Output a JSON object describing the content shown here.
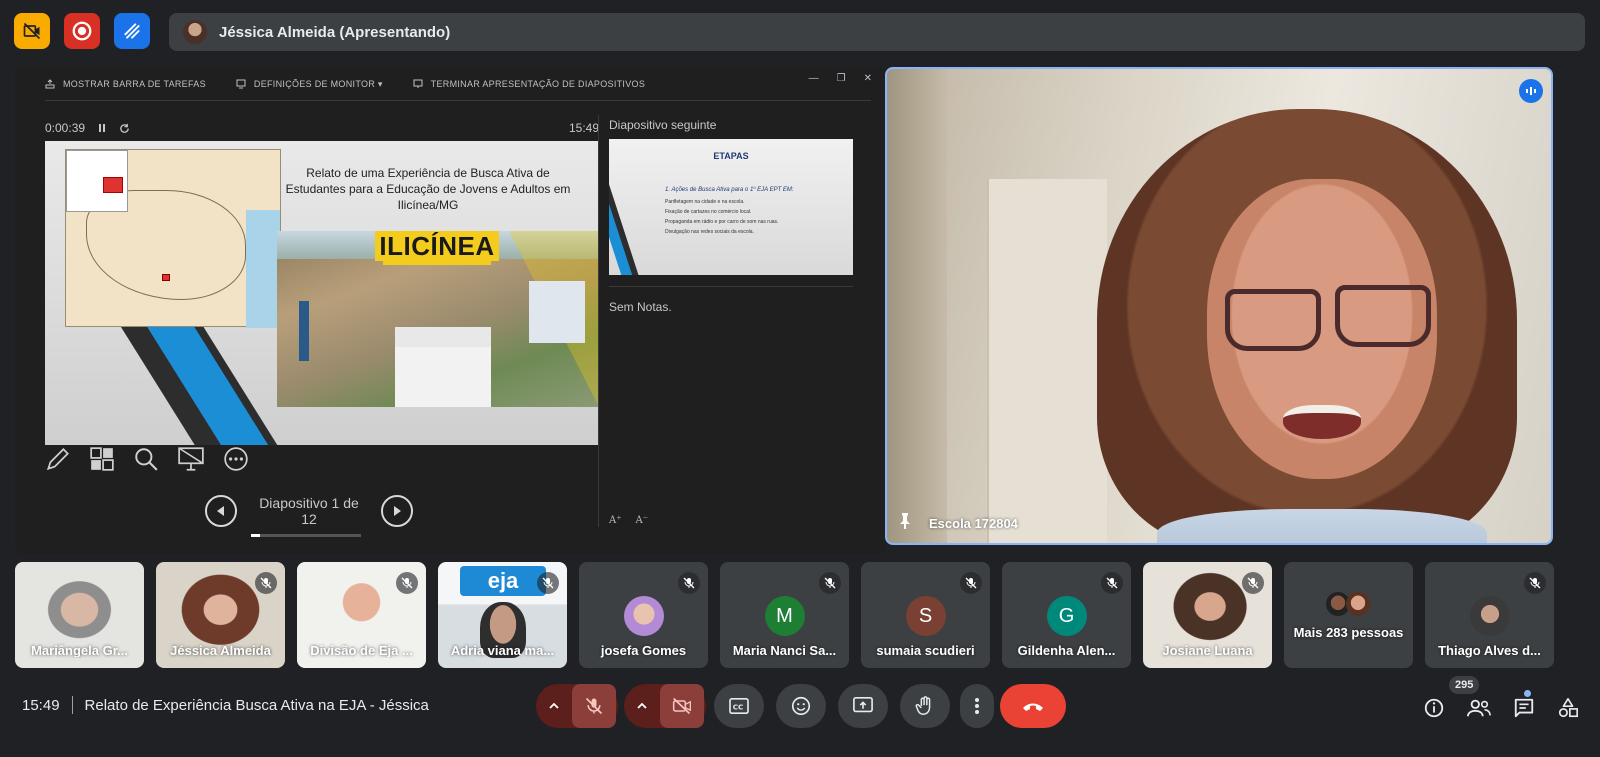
{
  "top": {
    "presenter_name": "Jéssica Almeida (Apresentando)"
  },
  "presentation": {
    "toolbar": {
      "show_taskbar": "MOSTRAR BARRA DE TAREFAS",
      "monitor_settings": "DEFINIÇÕES DE MONITOR ▾",
      "end_slideshow": "TERMINAR APRESENTAÇÃO DE DIAPOSITIVOS"
    },
    "elapsed": "0:00:39",
    "clock": "15:49",
    "slide": {
      "title": "Relato de uma Experiência de Busca Ativa de Estudantes para a Educação de Jovens e Adultos em Ilicínea/MG",
      "city_logo": "ILICÍNEA"
    },
    "next_label": "Diapositivo seguinte",
    "next_slide": {
      "title": "ETAPAS",
      "heading": "1. Ações de Busca Ativa para o 1º EJA EPT EM:",
      "items": [
        "Panfletagem na cidade e na escola.",
        "Fixação de cartazes no comércio local.",
        "Propaganda em rádio e por carro de som nas ruas.",
        "Divulgação nas redes sociais da escola."
      ]
    },
    "notes": "Sem Notas.",
    "counter": "Diapositivo 1 de 12",
    "font_larger": "A⁺",
    "font_smaller": "A⁻"
  },
  "main_video": {
    "label": "Escola 172804"
  },
  "participants": [
    {
      "name": "Mariângela Gr...",
      "type": "camera",
      "muted": false
    },
    {
      "name": "Jéssica Almeida",
      "type": "camera",
      "muted": true
    },
    {
      "name": "Divisão de Eja ...",
      "type": "camera",
      "muted": true
    },
    {
      "name": "Adria viana ma...",
      "type": "camera",
      "muted": true
    },
    {
      "name": "josefa Gomes",
      "type": "avatar",
      "muted": true
    },
    {
      "name": "Maria Nanci Sa...",
      "type": "initial",
      "initial": "M",
      "color": "#1e7e34",
      "muted": true
    },
    {
      "name": "sumaia scudieri",
      "type": "initial",
      "initial": "S",
      "color": "#7a4034",
      "muted": true
    },
    {
      "name": "Gildenha Alen...",
      "type": "initial",
      "initial": "G",
      "color": "#00897b",
      "muted": true
    },
    {
      "name": "Josiane Luana",
      "type": "camera",
      "muted": true
    },
    {
      "name": "Mais 283 pessoas",
      "type": "more",
      "muted": false
    },
    {
      "name": "Thiago Alves d...",
      "type": "avatar",
      "muted": true
    }
  ],
  "bottom": {
    "time": "15:49",
    "meeting_title": "Relato de Experiência Busca Ativa na EJA - Jéssica",
    "participant_count": "295"
  },
  "colors": {
    "background": "#202124",
    "tile": "#3c4043",
    "end_call": "#ea4335",
    "active_border": "#8ab4f8"
  }
}
